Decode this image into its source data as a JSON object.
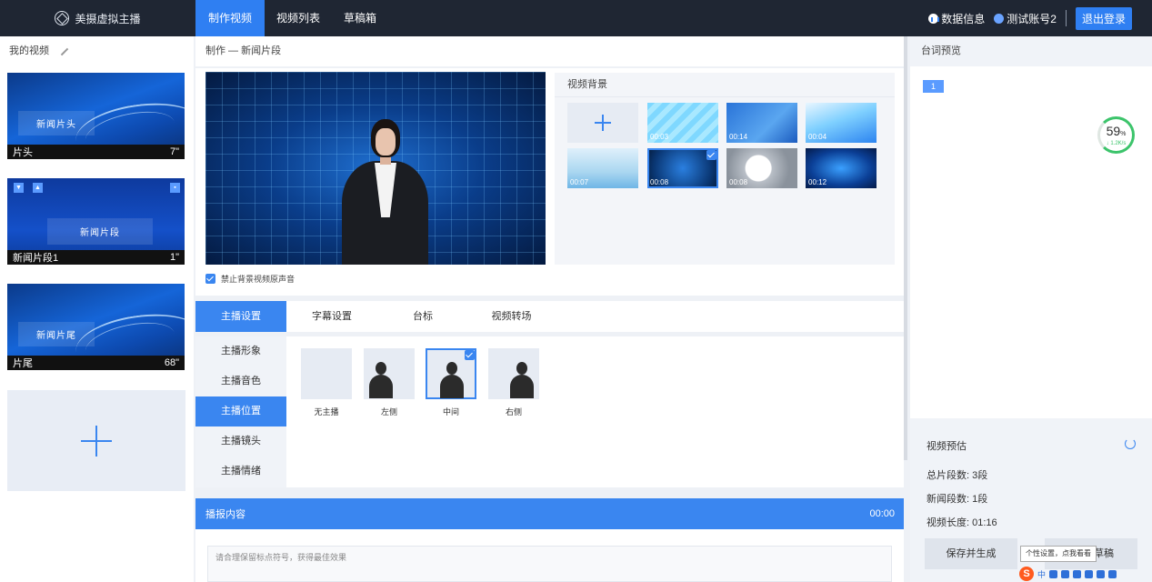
{
  "brand": {
    "name": "美摄虚拟主播"
  },
  "nav": {
    "tabs": [
      {
        "label": "制作视频"
      },
      {
        "label": "视频列表"
      },
      {
        "label": "草稿箱"
      }
    ]
  },
  "topright": {
    "data_info": "数据信息",
    "account": "测试账号2",
    "logout": "退出登录"
  },
  "left": {
    "title": "我的视频",
    "clips": [
      {
        "caption": "新闻片头",
        "name": "片头",
        "duration": "7\""
      },
      {
        "caption": "新闻片段",
        "name": "新闻片段1",
        "duration": "1\""
      },
      {
        "caption": "新闻片尾",
        "name": "片尾",
        "duration": "68\""
      }
    ]
  },
  "center": {
    "title": "制作 — 新闻片段",
    "mute_label": "禁止背景视频原声音",
    "background": {
      "title": "视频背景",
      "items": [
        {
          "duration": ""
        },
        {
          "duration": "00:03"
        },
        {
          "duration": "00:14"
        },
        {
          "duration": "00:04"
        },
        {
          "duration": "00:07"
        },
        {
          "duration": "00:08"
        },
        {
          "duration": "00:08"
        },
        {
          "duration": "00:12"
        }
      ]
    },
    "tabs": [
      {
        "label": "主播设置"
      },
      {
        "label": "字幕设置"
      },
      {
        "label": "台标"
      },
      {
        "label": "视频转场"
      }
    ],
    "menu": [
      {
        "label": "主播形象"
      },
      {
        "label": "主播音色"
      },
      {
        "label": "主播位置"
      },
      {
        "label": "主播镜头"
      },
      {
        "label": "主播情绪"
      }
    ],
    "positions": [
      {
        "label": "无主播"
      },
      {
        "label": "左侧"
      },
      {
        "label": "中间"
      },
      {
        "label": "右侧"
      }
    ],
    "broadcast": {
      "title": "播报内容",
      "time": "00:00"
    },
    "script_placeholder": "请合理保留标点符号，获得最佳效果"
  },
  "right": {
    "title": "台词预览",
    "tag": "1",
    "gauge": {
      "percent": "59",
      "unit": "%",
      "speed": "↓ 1.2K/s"
    },
    "estimate": {
      "title": "视频预估",
      "total": "总片段数: 3段",
      "news": "新闻段数: 1段",
      "length": "视频长度: 01:16"
    },
    "save_generate": "保存并生成",
    "save_draft": "草稿",
    "tooltip": "个性设置，点我看看"
  },
  "ime": {
    "s": "S",
    "zh": "中"
  },
  "colors": {
    "accent": "#3a86f0",
    "topbar": "#1f2633",
    "gauge": "#3cc46b"
  }
}
